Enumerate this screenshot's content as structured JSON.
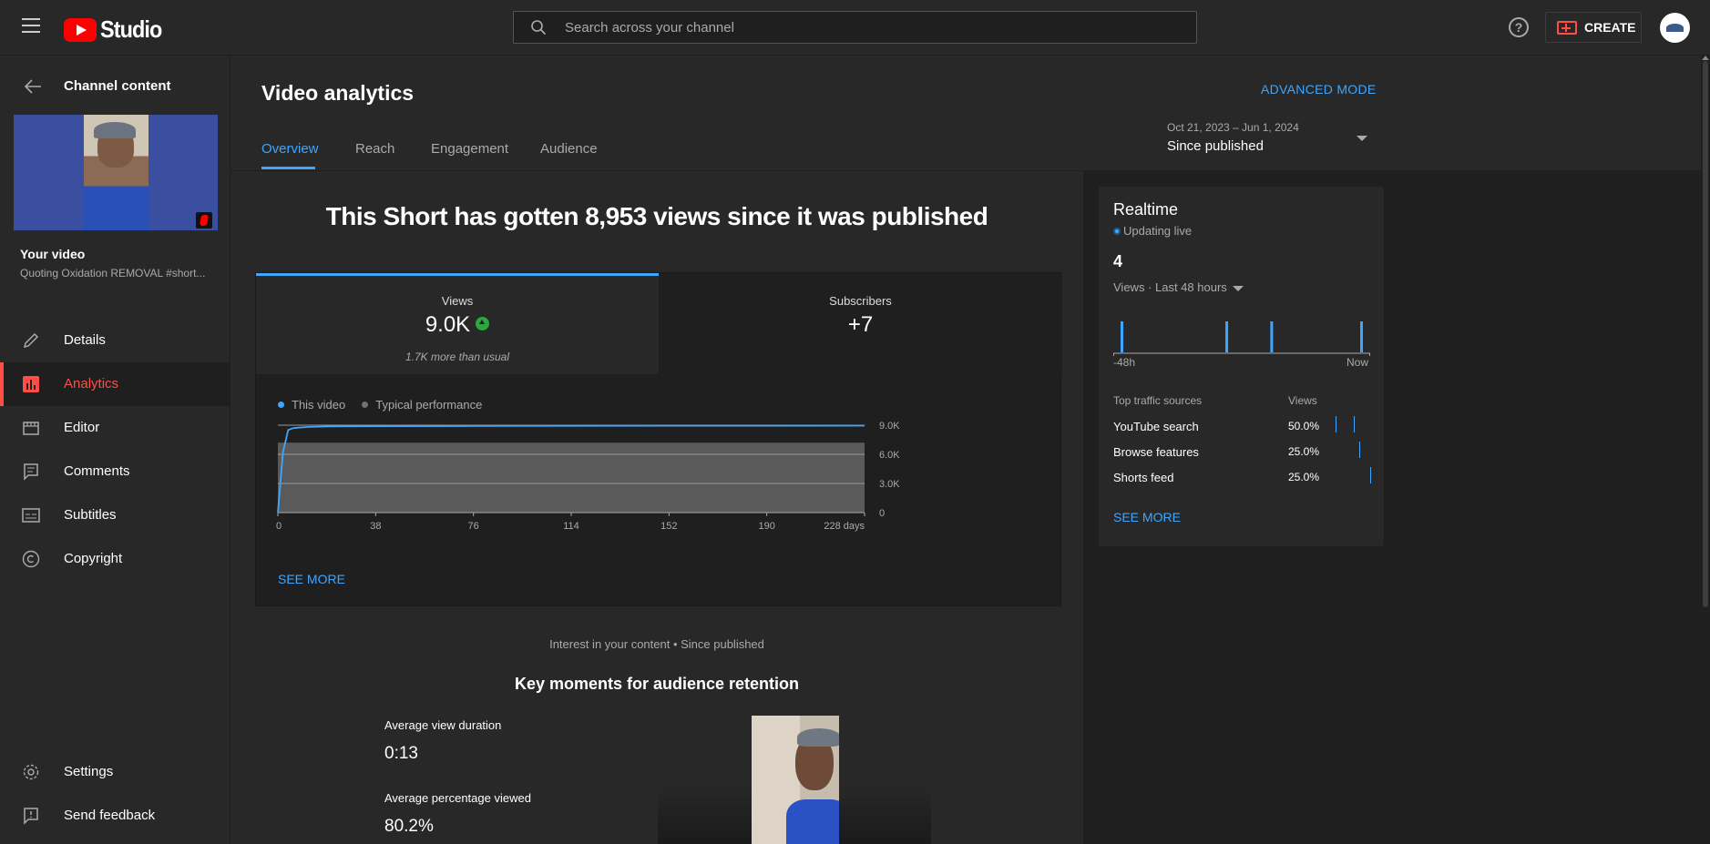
{
  "header": {
    "logo_text": "Studio",
    "search_placeholder": "Search across your channel",
    "help_glyph": "?",
    "create_label": "CREATE"
  },
  "sidebar": {
    "back_label": "Channel content",
    "your_video_label": "Your video",
    "video_title": "Quoting Oxidation REMOVAL #short...",
    "items": [
      {
        "label": "Details",
        "icon": "pencil-icon",
        "active": false
      },
      {
        "label": "Analytics",
        "icon": "analytics-icon",
        "active": true
      },
      {
        "label": "Editor",
        "icon": "editor-icon",
        "active": false
      },
      {
        "label": "Comments",
        "icon": "comments-icon",
        "active": false
      },
      {
        "label": "Subtitles",
        "icon": "subtitles-icon",
        "active": false
      },
      {
        "label": "Copyright",
        "icon": "copyright-icon",
        "active": false
      }
    ],
    "bottom_items": [
      {
        "label": "Settings",
        "icon": "gear-icon"
      },
      {
        "label": "Send feedback",
        "icon": "feedback-icon"
      }
    ]
  },
  "main": {
    "title": "Video analytics",
    "advanced_mode": "ADVANCED MODE",
    "tabs": [
      {
        "label": "Overview",
        "active": true
      },
      {
        "label": "Reach",
        "active": false
      },
      {
        "label": "Engagement",
        "active": false
      },
      {
        "label": "Audience",
        "active": false
      }
    ],
    "date_range": "Oct 21, 2023 – Jun 1, 2024",
    "date_label": "Since published",
    "headline": "This Short has gotten 8,953 views since it was published",
    "metrics": {
      "views_label": "Views",
      "views_value": "9.0K",
      "views_sub": "1.7K more than usual",
      "subs_label": "Subscribers",
      "subs_value": "+7"
    },
    "legend": {
      "this_video": "This video",
      "typical": "Typical performance"
    },
    "see_more": "SEE MORE",
    "interest_line": "Interest in your content • Since published",
    "key_moments_title": "Key moments for audience retention",
    "avg_view_duration_label": "Average view duration",
    "avg_view_duration_value": "0:13",
    "avg_pct_viewed_label": "Average percentage viewed",
    "avg_pct_viewed_value": "80.2%"
  },
  "chart_data": {
    "type": "area",
    "x": [
      0,
      2,
      4,
      6,
      8,
      12,
      16,
      20,
      38,
      76,
      114,
      152,
      190,
      228
    ],
    "x_tick_labels": [
      "0",
      "38",
      "76",
      "114",
      "152",
      "190",
      "228 days"
    ],
    "y_tick_labels": [
      "0",
      "3.0K",
      "6.0K",
      "9.0K"
    ],
    "ylim": [
      0,
      9000
    ],
    "xlim": [
      0,
      228
    ],
    "series": [
      {
        "name": "This video",
        "color": "#3ea6ff",
        "values": [
          0,
          6200,
          8500,
          8700,
          8750,
          8820,
          8850,
          8880,
          8900,
          8920,
          8930,
          8940,
          8948,
          8953
        ]
      },
      {
        "name": "Typical performance",
        "color": "#5a5a5a",
        "band_low": 0,
        "band_high": 7200
      }
    ],
    "grid": true
  },
  "realtime": {
    "title": "Realtime",
    "live_label": "Updating live",
    "count": "4",
    "sub_label": "Views · Last 48 hours",
    "axis_left": "-48h",
    "axis_right": "Now",
    "bars": [
      0.02,
      0.44,
      0.62,
      0.98
    ],
    "top_sources_header": "Top traffic sources",
    "views_header": "Views",
    "sources": [
      {
        "name": "YouTube search",
        "pct": "50.0%"
      },
      {
        "name": "Browse features",
        "pct": "25.0%"
      },
      {
        "name": "Shorts feed",
        "pct": "25.0%"
      }
    ],
    "see_more": "SEE MORE"
  },
  "colors": {
    "accent": "#3ea6ff",
    "active_nav": "#ff4e45",
    "brand_red": "#ff0000",
    "positive": "#2ba640"
  }
}
